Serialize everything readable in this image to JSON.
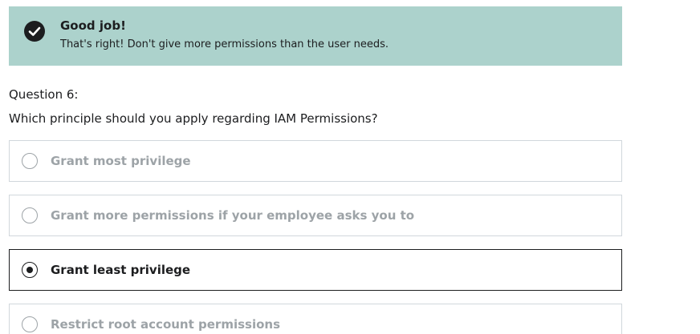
{
  "feedback": {
    "icon": "check-circle-icon",
    "title": "Good job!",
    "text": "That's right! Don't give more permissions than the user needs.",
    "background_color": "#acd2cc"
  },
  "question": {
    "number_label": "Question 6:",
    "prompt": "Which principle should you apply regarding IAM Permissions?"
  },
  "options": [
    {
      "label": "Grant most privilege",
      "selected": false
    },
    {
      "label": "Grant more permissions if your employee asks you to",
      "selected": false
    },
    {
      "label": "Grant least privilege",
      "selected": true
    },
    {
      "label": "Restrict root account permissions",
      "selected": false
    }
  ]
}
